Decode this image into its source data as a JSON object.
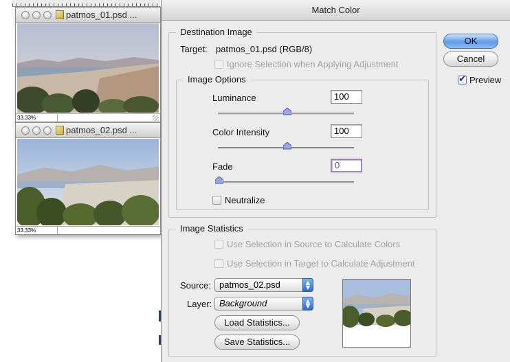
{
  "windows": [
    {
      "title": "patmos_01.psd ...",
      "zoom": "33.33%"
    },
    {
      "title": "patmos_02.psd ...",
      "zoom": "33.33%"
    }
  ],
  "dialog": {
    "title": "Match Color",
    "ok_label": "OK",
    "cancel_label": "Cancel",
    "preview_label": "Preview",
    "preview_checked": true,
    "destination": {
      "legend": "Destination Image",
      "target_label": "Target:",
      "target_value": "patmos_01.psd (RGB/8)",
      "ignore_selection_label": "Ignore Selection when Applying Adjustment"
    },
    "options": {
      "legend": "Image Options",
      "luminance_label": "Luminance",
      "luminance_value": "100",
      "luminance_level": 0.5,
      "intensity_label": "Color Intensity",
      "intensity_value": "100",
      "intensity_level": 0.5,
      "fade_label": "Fade",
      "fade_value": "0",
      "fade_level": 0,
      "neutralize_label": "Neutralize"
    },
    "stats": {
      "legend": "Image Statistics",
      "use_sel_source_label": "Use Selection in Source to Calculate Colors",
      "use_sel_target_label": "Use Selection in Target to Calculate Adjustment",
      "source_label": "Source:",
      "source_value": "patmos_02.psd",
      "layer_label": "Layer:",
      "layer_value": "Background",
      "load_label": "Load Statistics...",
      "save_label": "Save Statistics..."
    }
  },
  "colors": {
    "ok_button": "#5f9ae6",
    "checkbox_check": "#1b3e8f",
    "fade_field_border": "#9c82b8"
  }
}
